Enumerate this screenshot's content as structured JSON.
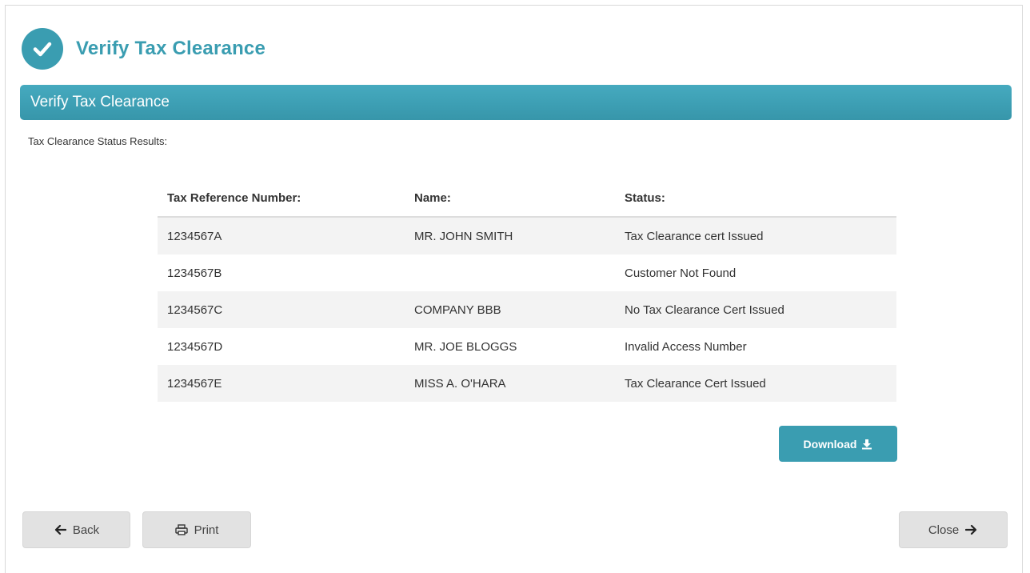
{
  "header": {
    "title": "Verify Tax Clearance",
    "icon": "check-circle-icon",
    "accent_color": "#3a9db1"
  },
  "section": {
    "title": "Verify Tax Clearance"
  },
  "results_label": "Tax Clearance Status Results:",
  "table": {
    "headers": [
      "Tax Reference Number:",
      "Name:",
      "Status:"
    ],
    "rows": [
      {
        "ref": "1234567A",
        "name": "MR. JOHN SMITH",
        "status": "Tax Clearance cert Issued"
      },
      {
        "ref": "1234567B",
        "name": "",
        "status": "Customer Not Found"
      },
      {
        "ref": "1234567C",
        "name": "COMPANY BBB",
        "status": "No Tax Clearance Cert Issued"
      },
      {
        "ref": "1234567D",
        "name": "MR. JOE BLOGGS",
        "status": "Invalid Access Number"
      },
      {
        "ref": "1234567E",
        "name": "MISS A. O'HARA",
        "status": "Tax Clearance Cert Issued"
      }
    ]
  },
  "actions": {
    "download_label": "Download",
    "download_icon": "download-icon",
    "back_label": "Back",
    "back_icon": "arrow-left-icon",
    "print_label": "Print",
    "print_icon": "printer-icon",
    "close_label": "Close",
    "close_icon": "arrow-right-icon"
  }
}
